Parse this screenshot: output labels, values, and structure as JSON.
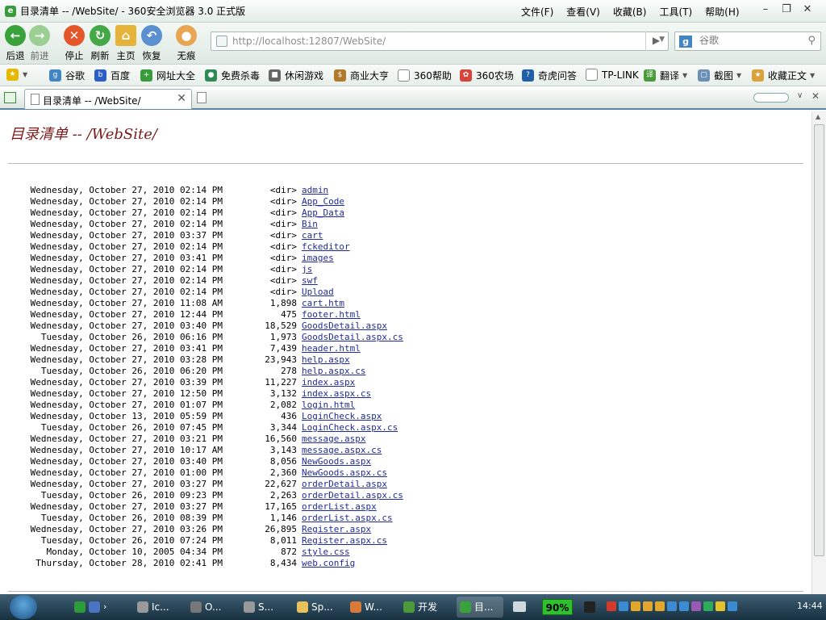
{
  "window": {
    "title": "目录清单 -- /WebSite/ - 360安全浏览器 3.0 正式版"
  },
  "menu": [
    "文件(F)",
    "查看(V)",
    "收藏(B)",
    "工具(T)",
    "帮助(H)"
  ],
  "toolbar": {
    "back": "后退",
    "forward": "前进",
    "stop": "停止",
    "refresh": "刷新",
    "home": "主页",
    "restore": "恢复",
    "incognito": "无痕"
  },
  "address": {
    "url": "http://localhost:12807/WebSite/"
  },
  "search": {
    "placeholder": "谷歌"
  },
  "favorites": [
    "谷歌",
    "百度",
    "网址大全",
    "免费杀毒",
    "休闲游戏",
    "商业大亨",
    "360帮助",
    "360农场",
    "奇虎问答",
    "TP-LINK",
    "翻译",
    "截图",
    "收藏正文"
  ],
  "tab": {
    "label": "目录清单 -- /WebSite/"
  },
  "page": {
    "heading": "目录清单 -- /WebSite/"
  },
  "listing": [
    {
      "date": "Wednesday, October 27, 2010 02:14 PM",
      "size": "<dir>",
      "name": "admin"
    },
    {
      "date": "Wednesday, October 27, 2010 02:14 PM",
      "size": "<dir>",
      "name": "App_Code"
    },
    {
      "date": "Wednesday, October 27, 2010 02:14 PM",
      "size": "<dir>",
      "name": "App_Data"
    },
    {
      "date": "Wednesday, October 27, 2010 02:14 PM",
      "size": "<dir>",
      "name": "Bin"
    },
    {
      "date": "Wednesday, October 27, 2010 03:37 PM",
      "size": "<dir>",
      "name": "cart"
    },
    {
      "date": "Wednesday, October 27, 2010 02:14 PM",
      "size": "<dir>",
      "name": "fckeditor"
    },
    {
      "date": "Wednesday, October 27, 2010 03:41 PM",
      "size": "<dir>",
      "name": "images"
    },
    {
      "date": "Wednesday, October 27, 2010 02:14 PM",
      "size": "<dir>",
      "name": "js"
    },
    {
      "date": "Wednesday, October 27, 2010 02:14 PM",
      "size": "<dir>",
      "name": "swf"
    },
    {
      "date": "Wednesday, October 27, 2010 02:14 PM",
      "size": "<dir>",
      "name": "Upload"
    },
    {
      "date": "Wednesday, October 27, 2010 11:08 AM",
      "size": "1,898",
      "name": "cart.htm"
    },
    {
      "date": "Wednesday, October 27, 2010 12:44 PM",
      "size": "475",
      "name": "footer.html"
    },
    {
      "date": "Wednesday, October 27, 2010 03:40 PM",
      "size": "18,529",
      "name": "GoodsDetail.aspx"
    },
    {
      "date": "Tuesday, October 26, 2010 06:16 PM",
      "size": "1,973",
      "name": "GoodsDetail.aspx.cs"
    },
    {
      "date": "Wednesday, October 27, 2010 03:41 PM",
      "size": "7,439",
      "name": "header.html"
    },
    {
      "date": "Wednesday, October 27, 2010 03:28 PM",
      "size": "23,943",
      "name": "help.aspx"
    },
    {
      "date": "Tuesday, October 26, 2010 06:20 PM",
      "size": "278",
      "name": "help.aspx.cs"
    },
    {
      "date": "Wednesday, October 27, 2010 03:39 PM",
      "size": "11,227",
      "name": "index.aspx"
    },
    {
      "date": "Wednesday, October 27, 2010 12:50 PM",
      "size": "3,132",
      "name": "index.aspx.cs"
    },
    {
      "date": "Wednesday, October 27, 2010 01:07 PM",
      "size": "2,082",
      "name": "login.html"
    },
    {
      "date": "Wednesday, October 13, 2010 05:59 PM",
      "size": "436",
      "name": "LoginCheck.aspx"
    },
    {
      "date": "Tuesday, October 26, 2010 07:45 PM",
      "size": "3,344",
      "name": "LoginCheck.aspx.cs"
    },
    {
      "date": "Wednesday, October 27, 2010 03:21 PM",
      "size": "16,560",
      "name": "message.aspx"
    },
    {
      "date": "Wednesday, October 27, 2010 10:17 AM",
      "size": "3,143",
      "name": "message.aspx.cs"
    },
    {
      "date": "Wednesday, October 27, 2010 03:40 PM",
      "size": "8,056",
      "name": "NewGoods.aspx"
    },
    {
      "date": "Wednesday, October 27, 2010 01:00 PM",
      "size": "2,360",
      "name": "NewGoods.aspx.cs"
    },
    {
      "date": "Wednesday, October 27, 2010 03:27 PM",
      "size": "22,627",
      "name": "orderDetail.aspx"
    },
    {
      "date": "Tuesday, October 26, 2010 09:23 PM",
      "size": "2,263",
      "name": "orderDetail.aspx.cs"
    },
    {
      "date": "Wednesday, October 27, 2010 03:27 PM",
      "size": "17,165",
      "name": "orderList.aspx"
    },
    {
      "date": "Tuesday, October 26, 2010 08:39 PM",
      "size": "1,146",
      "name": "orderList.aspx.cs"
    },
    {
      "date": "Wednesday, October 27, 2010 03:26 PM",
      "size": "26,895",
      "name": "Register.aspx"
    },
    {
      "date": "Tuesday, October 26, 2010 07:24 PM",
      "size": "8,011",
      "name": "Register.aspx.cs"
    },
    {
      "date": "Monday, October 10, 2005 04:34 PM",
      "size": "872",
      "name": "style.css"
    },
    {
      "date": "Thursday, October 28, 2010 02:41 PM",
      "size": "8,434",
      "name": "web.config"
    }
  ],
  "taskbar": {
    "tasks": [
      "Ic...",
      "O...",
      "S...",
      "Sp...",
      "W...",
      "开发",
      "目..."
    ],
    "battery": "90%",
    "clock": "14:44"
  },
  "colors": {
    "link": "#1f2b9c",
    "heading": "#7a1b1b",
    "battery": "#2ec02e"
  }
}
